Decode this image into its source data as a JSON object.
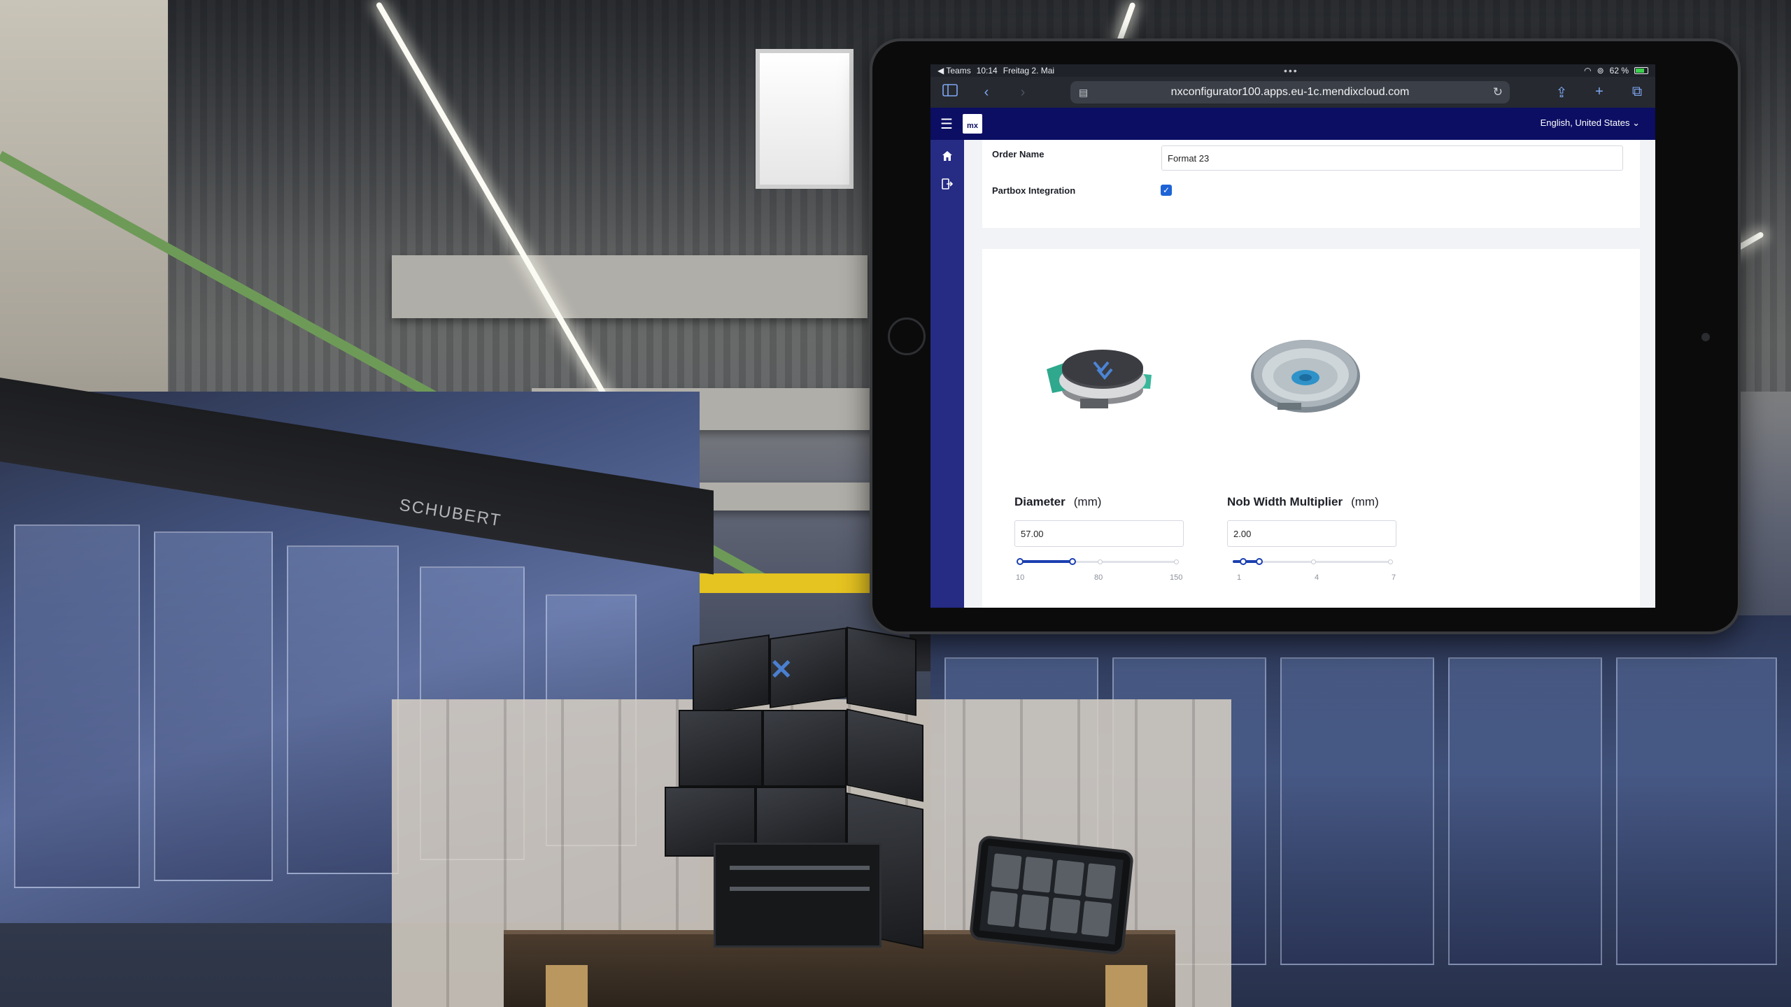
{
  "status_bar": {
    "back_app": "◀ Teams",
    "time": "10:14",
    "date": "Freitag 2. Mai",
    "battery": "62 %"
  },
  "browser": {
    "url": "nxconfigurator100.apps.eu-1c.mendixcloud.com"
  },
  "app": {
    "logo": "mx",
    "language": "English, United States"
  },
  "form": {
    "order_name_label": "Order Name",
    "order_name_value": "Format 23",
    "partbox_label": "Partbox Integration",
    "partbox_checked": true
  },
  "parameters": {
    "diameter": {
      "label": "Diameter",
      "unit": "(mm)",
      "value": "57.00",
      "slider_value": 57,
      "min": 10,
      "max": 150,
      "ticks": [
        "10",
        "80",
        "150"
      ]
    },
    "nob_width": {
      "label": "Nob Width Multiplier",
      "unit": "(mm)",
      "value": "2.00",
      "slider_value": 2,
      "min": 1,
      "max": 7,
      "ticks": [
        "1",
        "4",
        "7"
      ]
    }
  },
  "background": {
    "brand_sign": "SCHUBERT"
  },
  "colors": {
    "app_header": "#0b0e63",
    "side_nav": "#262b84",
    "slider_accent": "#1b3fb0",
    "checkbox": "#1e63d6"
  },
  "icons": {
    "home": "home-icon",
    "logout": "logout-icon",
    "menu": "hamburger-icon"
  }
}
